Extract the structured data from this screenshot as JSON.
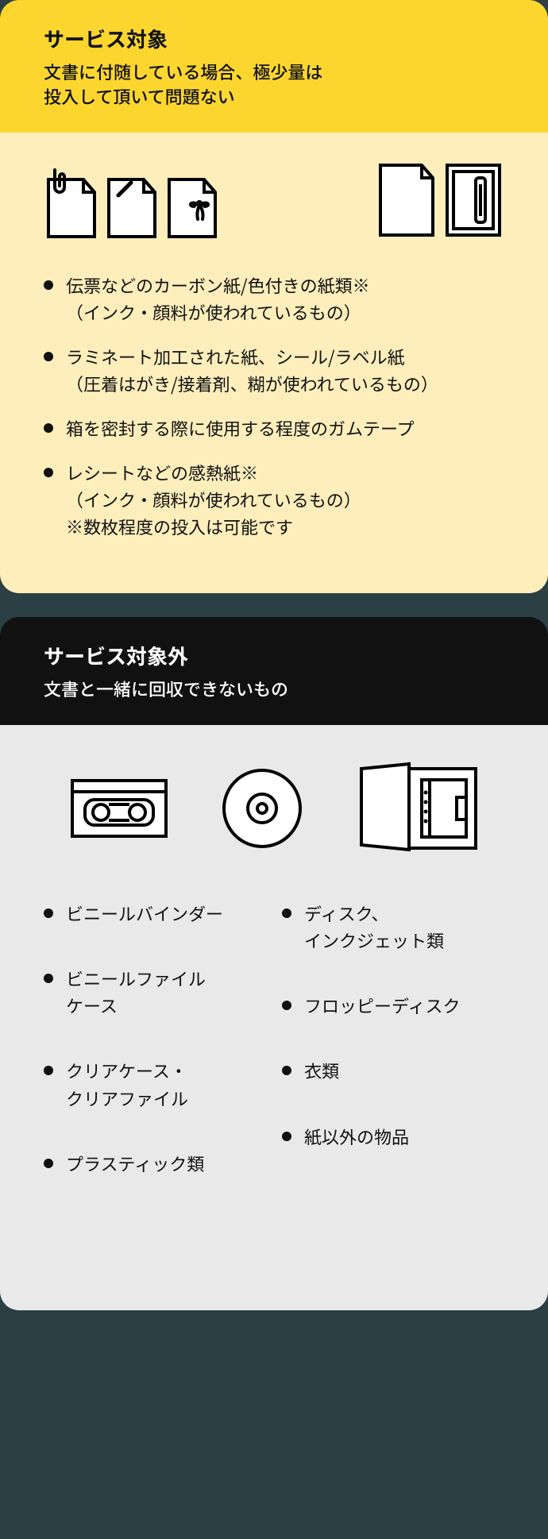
{
  "section_in": {
    "title": "サービス対象",
    "subtitle": "文書に付随している場合、極少量は\n投入して頂いて問題ない",
    "items": [
      {
        "main": "伝票などのカーボン紙/色付きの紙類※",
        "sub": "（インク・顔料が使われているもの）"
      },
      {
        "main": "ラミネート加工された紙、シール/ラベル紙",
        "sub": "（圧着はがき/接着剤、糊が使われているもの）"
      },
      {
        "main": "箱を密封する際に使用する程度のガムテープ",
        "sub": ""
      },
      {
        "main": "レシートなどの感熱紙※",
        "sub": "（インク・顔料が使われているもの）\n※数枚程度の投入は可能です"
      }
    ]
  },
  "section_out": {
    "title": "サービス対象外",
    "subtitle": "文書と一緒に回収できないもの",
    "left": [
      "ビニールバインダー",
      "ビニールファイル\nケース",
      "クリアケース・\nクリアファイル",
      "プラスティック類"
    ],
    "right": [
      "ディスク、\nインクジェット類",
      "フロッピーディスク",
      "衣類",
      "紙以外の物品"
    ]
  }
}
